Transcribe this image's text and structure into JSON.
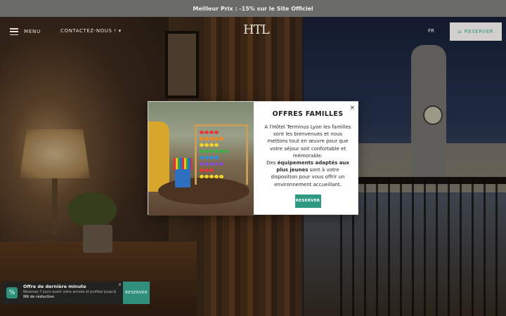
{
  "promo_bar": {
    "text": "Meilleur Prix : -15% sur le Site Officiel"
  },
  "header": {
    "menu_label": "MENU",
    "contact_label": "CONTACTEZ-NOUS !",
    "logo_text": "HTL",
    "language": "FR",
    "reserve_label": "RESERVER"
  },
  "modal": {
    "title": "OFFRES FAMILLES",
    "close_symbol": "×",
    "paragraph1": "A l'Hôtel Terminus Lyon les familles sont les bienvenues et nous mettons tout en œuvre pour que votre séjour soit confortable et mémorable.",
    "paragraph2_before": "Des ",
    "paragraph2_bold": "équipements adaptés aux plus jeunes",
    "paragraph2_after": " sont à votre disposition pour vous offrir un environnement accueillant.",
    "cta_label": "RESERVER"
  },
  "toast": {
    "title": "Offre de dernière minute",
    "desc_before": "Réservez 7 jours avant votre arrivée et profitez jusqu'à ",
    "desc_bold": "NN de réduction",
    "close_symbol": "×",
    "cta_label": "RESERVER"
  },
  "colors": {
    "accent": "#2f9a82",
    "promo_bg": "#6b6b68"
  },
  "icons": {
    "menu": "hamburger-icon",
    "reserve": "home-icon",
    "toast": "percent-icon",
    "dropdown": "caret-down-icon"
  }
}
